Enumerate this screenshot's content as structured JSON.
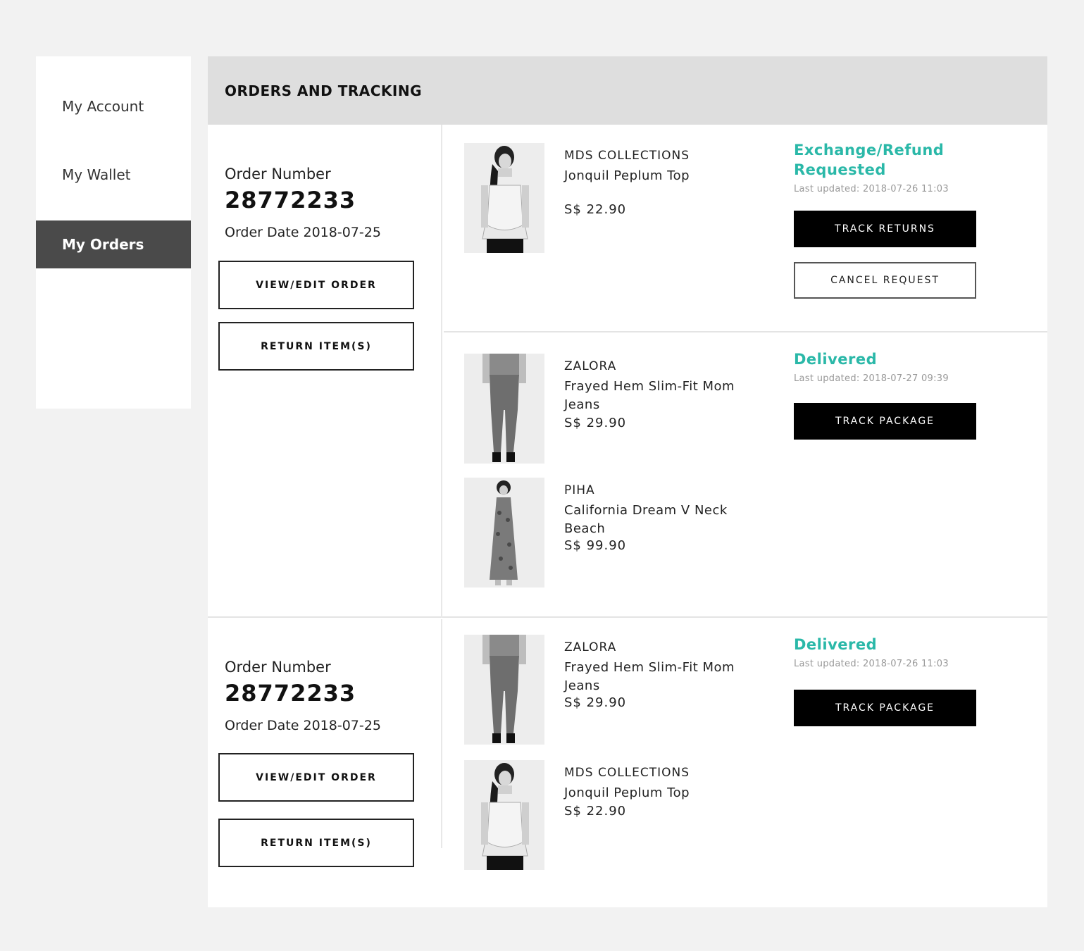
{
  "sidebar": {
    "items": [
      {
        "label": "My Account"
      },
      {
        "label": "My Wallet"
      },
      {
        "label": "My Orders"
      }
    ]
  },
  "header": {
    "title": "ORDERS AND TRACKING"
  },
  "orders": [
    {
      "number_label": "Order Number",
      "number": "28772233",
      "date": "Order Date 2018-07-25",
      "view_edit_label": "VIEW/EDIT ORDER",
      "return_label": "RETURN ITEM(S)",
      "groups": [
        {
          "status": "Exchange/Refund Requested",
          "updated": "Last updated: 2018-07-26 11:03",
          "primary_action": "TRACK RETURNS",
          "secondary_action": "CANCEL REQUEST",
          "items": [
            {
              "brand": "MDS COLLECTIONS",
              "name": "Jonquil Peplum Top",
              "price": "S$ 22.90",
              "image": "peplum-top-photo"
            }
          ]
        },
        {
          "status": "Delivered",
          "updated": "Last updated: 2018-07-27 09:39",
          "primary_action": "TRACK PACKAGE",
          "items": [
            {
              "brand": "ZALORA",
              "name": "Frayed Hem Slim-Fit Mom Jeans",
              "price": "S$ 29.90",
              "image": "jeans-photo"
            },
            {
              "brand": "PIHA",
              "name": "California Dream V Neck Beach",
              "price": "S$ 99.90",
              "image": "beach-dress-photo"
            }
          ]
        }
      ]
    },
    {
      "number_label": "Order Number",
      "number": "28772233",
      "date": "Order Date 2018-07-25",
      "view_edit_label": "VIEW/EDIT ORDER",
      "return_label": "RETURN ITEM(S)",
      "groups": [
        {
          "status": "Delivered",
          "updated": "Last updated: 2018-07-26 11:03",
          "primary_action": "TRACK PACKAGE",
          "items": [
            {
              "brand": "ZALORA",
              "name": "Frayed Hem Slim-Fit Mom Jeans",
              "price": "S$ 29.90",
              "image": "jeans-photo"
            },
            {
              "brand": "MDS COLLECTIONS",
              "name": "Jonquil Peplum Top",
              "price": "S$ 22.90",
              "image": "peplum-top-photo"
            }
          ]
        }
      ]
    }
  ],
  "colors": {
    "status_accent": "#2ab8a8",
    "active_nav": "#4a4a4a",
    "header_bg": "#dedede"
  }
}
